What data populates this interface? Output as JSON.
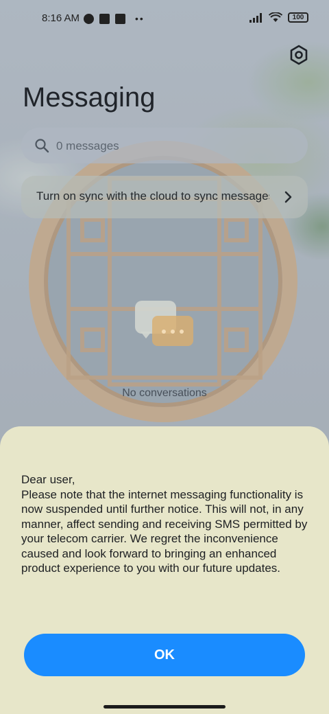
{
  "status_bar": {
    "time": "8:16 AM",
    "battery": "100",
    "icons": [
      "data-saver-icon",
      "app-notification-icon",
      "upload-icon",
      "more-dots-icon",
      "signal-icon",
      "wifi-icon",
      "battery-icon"
    ]
  },
  "header": {
    "title": "Messaging",
    "settings_icon": "gear-icon"
  },
  "search": {
    "placeholder": "0 messages",
    "icon": "search-icon"
  },
  "sync_banner": {
    "text": "Turn on sync with the cloud to sync messages",
    "icon": "chevron-right-icon"
  },
  "empty_state": {
    "label": "No conversations"
  },
  "dialog": {
    "greeting": "Dear user,",
    "body": "Please note that the internet messaging functionality is now suspended until further notice. This will not, in any manner, affect sending and receiving SMS permitted by your telecom carrier. We regret the inconvenience caused and look forward to bringing an enhanced product experience to you with our future updates.",
    "ok_label": "OK"
  },
  "colors": {
    "accent": "#1a8cff",
    "sheet_bg": "#e7e6c9"
  }
}
